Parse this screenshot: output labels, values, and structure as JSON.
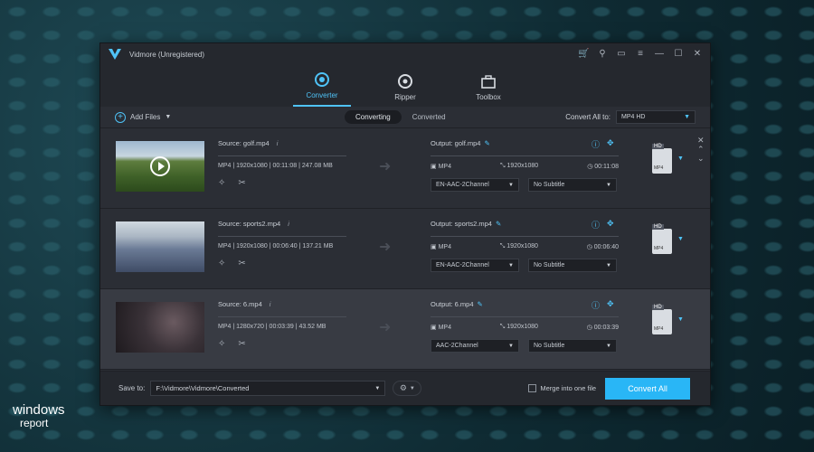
{
  "window": {
    "title": "Vidmore (Unregistered)"
  },
  "nav": {
    "tabs": [
      {
        "label": "Converter"
      },
      {
        "label": "Ripper"
      },
      {
        "label": "Toolbox"
      }
    ]
  },
  "toolbar": {
    "add_files": "Add Files",
    "segment": {
      "converting": "Converting",
      "converted": "Converted"
    },
    "convert_all_to_label": "Convert All to:",
    "convert_all_to_value": "MP4 HD"
  },
  "files": [
    {
      "source": "Source: golf.mp4",
      "meta": "MP4 | 1920x1080 | 00:11:08 | 247.08 MB",
      "output": "Output: golf.mp4",
      "format": "MP4",
      "resolution": "1920x1080",
      "duration": "00:11:08",
      "audio": "EN-AAC-2Channel",
      "subtitle": "No Subtitle"
    },
    {
      "source": "Source: sports2.mp4",
      "meta": "MP4 | 1920x1080 | 00:06:40 | 137.21 MB",
      "output": "Output: sports2.mp4",
      "format": "MP4",
      "resolution": "1920x1080",
      "duration": "00:06:40",
      "audio": "EN-AAC-2Channel",
      "subtitle": "No Subtitle"
    },
    {
      "source": "Source: 6.mp4",
      "meta": "MP4 | 1280x720 | 00:03:39 | 43.52 MB",
      "output": "Output: 6.mp4",
      "format": "MP4",
      "resolution": "1920x1080",
      "duration": "00:03:39",
      "audio": "AAC-2Channel",
      "subtitle": "No Subtitle"
    }
  ],
  "footer": {
    "save_to_label": "Save to:",
    "save_path": "F:\\Vidmore\\Vidmore\\Converted",
    "merge_label": "Merge into one file",
    "convert_all": "Convert All"
  },
  "badge": {
    "hd": "HD",
    "mp4": "MP4"
  },
  "watermark": {
    "line1": "windows",
    "line2": "report"
  },
  "colors": {
    "accent": "#29b6f6",
    "window_bg": "#2b2e35"
  }
}
